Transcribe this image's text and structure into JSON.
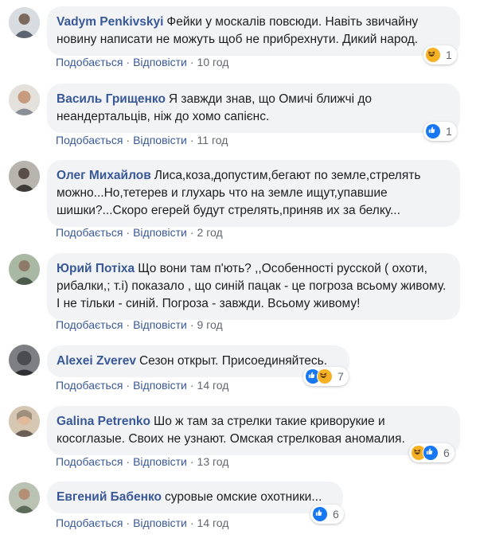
{
  "actions": {
    "like_label": "Подобається",
    "reply_label": "Відповісти",
    "separator": "·"
  },
  "comments": [
    {
      "author": "Vadym Penkivskyi",
      "text": "Фейки у москалів повсюди. Навіть звичайну новину написати не можуть щоб не прибрехнути. Дикий народ.",
      "time": "10 год",
      "reactions": [
        "haha"
      ],
      "reaction_count": "1"
    },
    {
      "author": "Василь Грищенко",
      "text": "Я завжди знав, що Омичі ближчі до неандертальців, ніж до хомо сапієнс.",
      "time": "11 год",
      "reactions": [
        "like"
      ],
      "reaction_count": "1"
    },
    {
      "author": "Олег Михайлов",
      "text": "Лиса,коза,допустим,бегают по земле,стрелять можно...Но,тетерев и глухарь что на земле ищут,упавшие шишки?...Скоро егерей будут стрелять,приняв их за белку...",
      "time": "2 год",
      "reactions": [],
      "reaction_count": ""
    },
    {
      "author": "Юрий Потіха",
      "text": "Що вони там п'ють? ,,Особенності русской ( охоти, рибалки,; т.і) показало , що синій пацак - це погроза всьому живому. І не тільки - синій. Погроза - завжди. Всьому живому!",
      "time": "9 год",
      "reactions": [],
      "reaction_count": ""
    },
    {
      "author": "Alexei Zverev",
      "text": "Сезон открыт. Присоединяйтесь.",
      "time": "14 год",
      "reactions": [
        "like",
        "haha"
      ],
      "reaction_count": "7"
    },
    {
      "author": "Galina Petrenko",
      "text": "Шо ж там за стрелки такие криворукие и косоглазые. Своих не узнают. Омская стрелковая аномалия.",
      "time": "13 год",
      "reactions": [
        "haha",
        "like"
      ],
      "reaction_count": "6"
    },
    {
      "author": "Евгений Бабенко",
      "text": "суровые омские охотники...",
      "time": "14 год",
      "reactions": [
        "like"
      ],
      "reaction_count": "6"
    }
  ],
  "colors": {
    "link": "#385898",
    "bubble": "#f2f3f5",
    "like": "#1877f2",
    "haha": "#f7b125"
  }
}
